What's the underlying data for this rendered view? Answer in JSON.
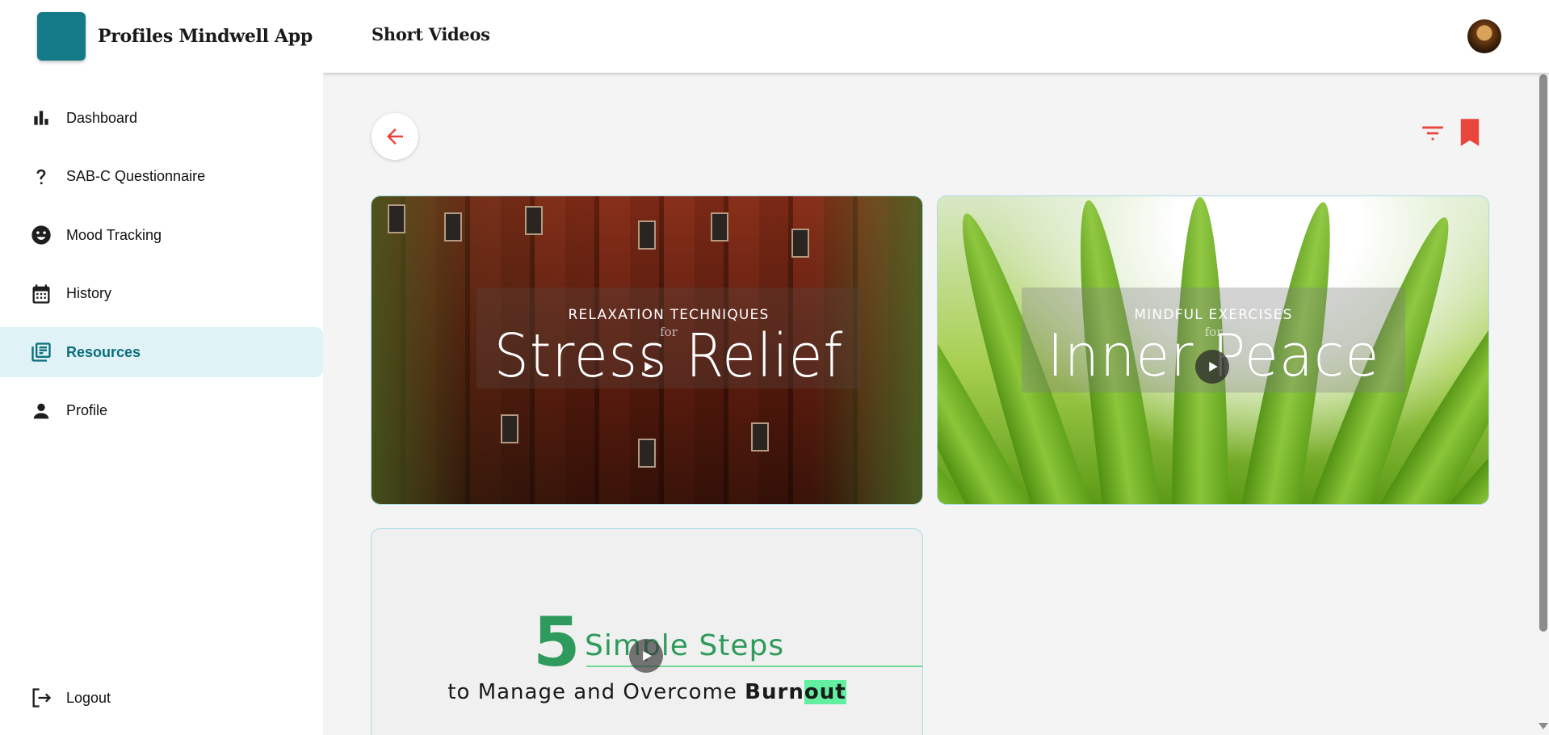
{
  "app": {
    "name": "Profiles Mindwell App"
  },
  "header": {
    "title": "Short Videos"
  },
  "sidebar": {
    "items": [
      {
        "label": "Dashboard",
        "icon": "bar-chart-icon"
      },
      {
        "label": "SAB-C Questionnaire",
        "icon": "question-mark-icon"
      },
      {
        "label": "Mood Tracking",
        "icon": "smiley-face-icon"
      },
      {
        "label": "History",
        "icon": "calendar-icon"
      },
      {
        "label": "Resources",
        "icon": "library-books-icon",
        "active": true
      },
      {
        "label": "Profile",
        "icon": "person-icon"
      }
    ],
    "logout": {
      "label": "Logout",
      "icon": "logout-icon"
    }
  },
  "toolbar": {
    "back_icon": "arrow-left-icon",
    "filter_icon": "filter-list-icon",
    "bookmark_icon": "bookmark-icon"
  },
  "videos": [
    {
      "kicker": "RELAXATION TECHNIQUES",
      "connector": "for",
      "title": "Stress Relief"
    },
    {
      "kicker": "MINDFUL EXERCISES",
      "connector": "for",
      "title": "Inner Peace"
    },
    {
      "number": "5",
      "title": "Simple Steps",
      "subtitle_prefix": "to Manage and Overcome ",
      "subtitle_bold": "Burn",
      "subtitle_highlight": "out"
    }
  ],
  "colors": {
    "accent": "#0b6e7d",
    "brand": "#157a88",
    "active_bg": "#dff2f5",
    "action_red": "#e8453c",
    "card_border": "#a9dbe3",
    "green": "#2e9a5c"
  }
}
